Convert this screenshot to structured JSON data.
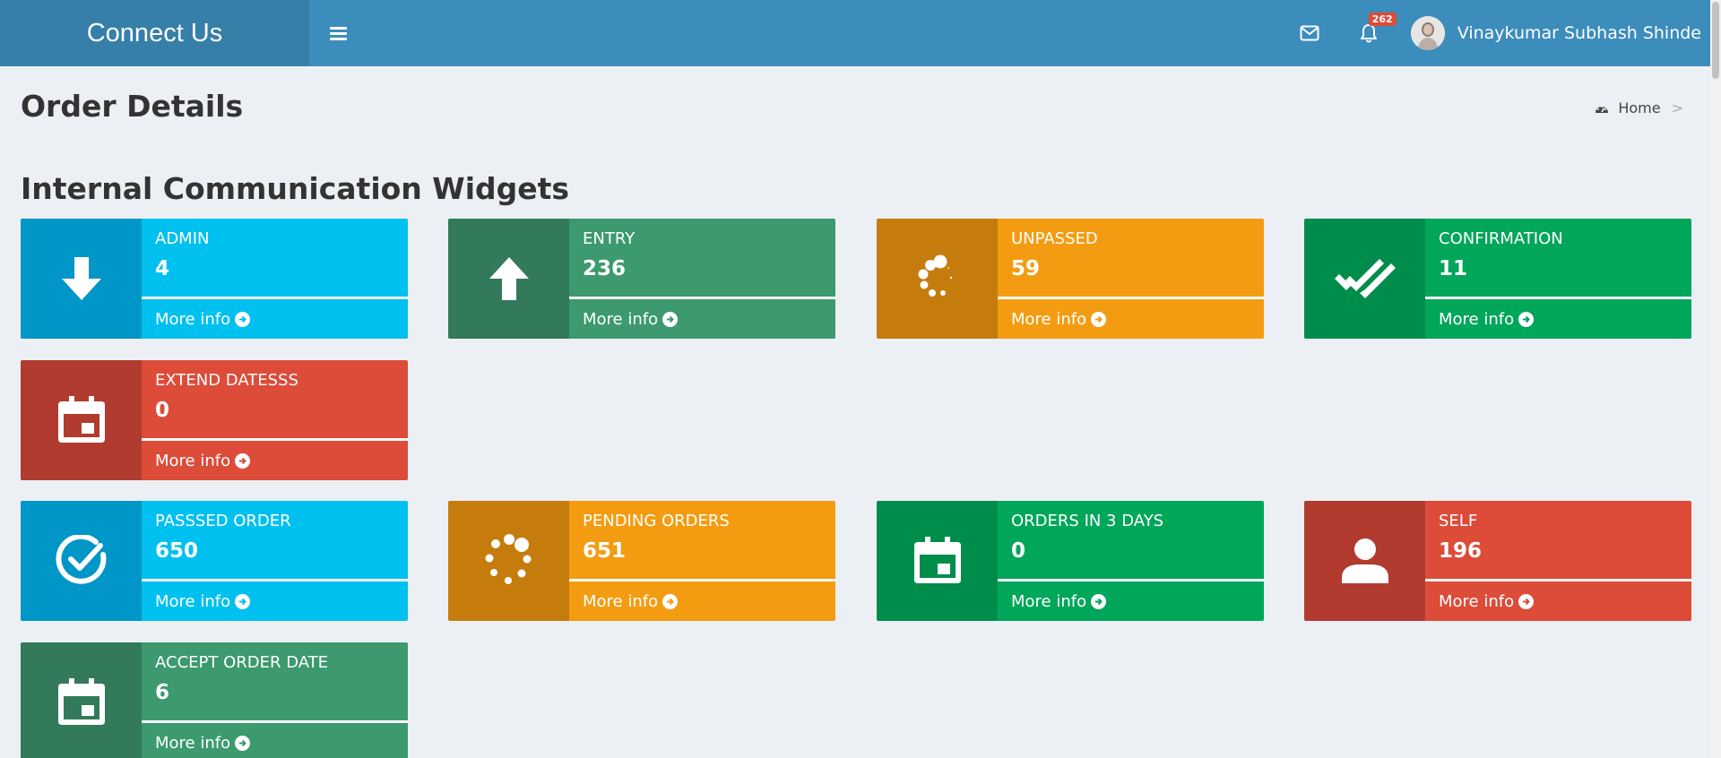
{
  "header": {
    "logo": "Connect Us",
    "notifications_count": "262",
    "user_name": "Vinaykumar Subhash Shinde"
  },
  "content": {
    "page_title": "Order Details",
    "breadcrumb_home": "Home",
    "breadcrumb_sep": ">",
    "section_title": "Internal Communication Widgets"
  },
  "widgets": [
    {
      "label": "ADMIN",
      "value": "4",
      "more": "More info",
      "color": "aqua",
      "icon": "arrow-down-icon"
    },
    {
      "label": "ENTRY",
      "value": "236",
      "more": "More info",
      "color": "teal",
      "icon": "arrow-up-icon"
    },
    {
      "label": "UNPASSED",
      "value": "59",
      "more": "More info",
      "color": "orange",
      "icon": "spinner-icon"
    },
    {
      "label": "CONFIRMATION",
      "value": "11",
      "more": "More info",
      "color": "green",
      "icon": "double-check-icon"
    },
    {
      "label": "EXTEND DATESSS",
      "value": "0",
      "more": "More info",
      "color": "red",
      "icon": "calendar-icon"
    },
    {
      "label": "PASSSED ORDER",
      "value": "650",
      "more": "More info",
      "color": "aqua",
      "icon": "check-circle-icon"
    },
    {
      "label": "PENDING ORDERS",
      "value": "651",
      "more": "More info",
      "color": "orange",
      "icon": "spinner-icon"
    },
    {
      "label": "ORDERS IN 3 DAYS",
      "value": "0",
      "more": "More info",
      "color": "green",
      "icon": "calendar-icon"
    },
    {
      "label": "SELF",
      "value": "196",
      "more": "More info",
      "color": "red",
      "icon": "user-icon"
    },
    {
      "label": "ACCEPT ORDER DATE",
      "value": "6",
      "more": "More info",
      "color": "teal",
      "icon": "calendar-icon"
    }
  ],
  "colors": {
    "header": "#3c8dbc",
    "logo_bg": "#367fa9",
    "aqua": "#00c0ef",
    "teal": "#3c9a6e",
    "orange": "#f39c12",
    "green": "#00a65a",
    "red": "#dd4b39"
  }
}
